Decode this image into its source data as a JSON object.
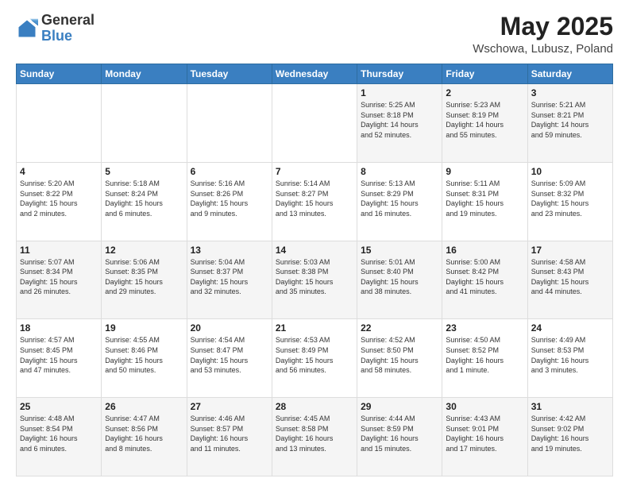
{
  "logo": {
    "general": "General",
    "blue": "Blue"
  },
  "header": {
    "title": "May 2025",
    "subtitle": "Wschowa, Lubusz, Poland"
  },
  "days_of_week": [
    "Sunday",
    "Monday",
    "Tuesday",
    "Wednesday",
    "Thursday",
    "Friday",
    "Saturday"
  ],
  "weeks": [
    [
      {
        "day": "",
        "info": ""
      },
      {
        "day": "",
        "info": ""
      },
      {
        "day": "",
        "info": ""
      },
      {
        "day": "",
        "info": ""
      },
      {
        "day": "1",
        "info": "Sunrise: 5:25 AM\nSunset: 8:18 PM\nDaylight: 14 hours\nand 52 minutes."
      },
      {
        "day": "2",
        "info": "Sunrise: 5:23 AM\nSunset: 8:19 PM\nDaylight: 14 hours\nand 55 minutes."
      },
      {
        "day": "3",
        "info": "Sunrise: 5:21 AM\nSunset: 8:21 PM\nDaylight: 14 hours\nand 59 minutes."
      }
    ],
    [
      {
        "day": "4",
        "info": "Sunrise: 5:20 AM\nSunset: 8:22 PM\nDaylight: 15 hours\nand 2 minutes."
      },
      {
        "day": "5",
        "info": "Sunrise: 5:18 AM\nSunset: 8:24 PM\nDaylight: 15 hours\nand 6 minutes."
      },
      {
        "day": "6",
        "info": "Sunrise: 5:16 AM\nSunset: 8:26 PM\nDaylight: 15 hours\nand 9 minutes."
      },
      {
        "day": "7",
        "info": "Sunrise: 5:14 AM\nSunset: 8:27 PM\nDaylight: 15 hours\nand 13 minutes."
      },
      {
        "day": "8",
        "info": "Sunrise: 5:13 AM\nSunset: 8:29 PM\nDaylight: 15 hours\nand 16 minutes."
      },
      {
        "day": "9",
        "info": "Sunrise: 5:11 AM\nSunset: 8:31 PM\nDaylight: 15 hours\nand 19 minutes."
      },
      {
        "day": "10",
        "info": "Sunrise: 5:09 AM\nSunset: 8:32 PM\nDaylight: 15 hours\nand 23 minutes."
      }
    ],
    [
      {
        "day": "11",
        "info": "Sunrise: 5:07 AM\nSunset: 8:34 PM\nDaylight: 15 hours\nand 26 minutes."
      },
      {
        "day": "12",
        "info": "Sunrise: 5:06 AM\nSunset: 8:35 PM\nDaylight: 15 hours\nand 29 minutes."
      },
      {
        "day": "13",
        "info": "Sunrise: 5:04 AM\nSunset: 8:37 PM\nDaylight: 15 hours\nand 32 minutes."
      },
      {
        "day": "14",
        "info": "Sunrise: 5:03 AM\nSunset: 8:38 PM\nDaylight: 15 hours\nand 35 minutes."
      },
      {
        "day": "15",
        "info": "Sunrise: 5:01 AM\nSunset: 8:40 PM\nDaylight: 15 hours\nand 38 minutes."
      },
      {
        "day": "16",
        "info": "Sunrise: 5:00 AM\nSunset: 8:42 PM\nDaylight: 15 hours\nand 41 minutes."
      },
      {
        "day": "17",
        "info": "Sunrise: 4:58 AM\nSunset: 8:43 PM\nDaylight: 15 hours\nand 44 minutes."
      }
    ],
    [
      {
        "day": "18",
        "info": "Sunrise: 4:57 AM\nSunset: 8:45 PM\nDaylight: 15 hours\nand 47 minutes."
      },
      {
        "day": "19",
        "info": "Sunrise: 4:55 AM\nSunset: 8:46 PM\nDaylight: 15 hours\nand 50 minutes."
      },
      {
        "day": "20",
        "info": "Sunrise: 4:54 AM\nSunset: 8:47 PM\nDaylight: 15 hours\nand 53 minutes."
      },
      {
        "day": "21",
        "info": "Sunrise: 4:53 AM\nSunset: 8:49 PM\nDaylight: 15 hours\nand 56 minutes."
      },
      {
        "day": "22",
        "info": "Sunrise: 4:52 AM\nSunset: 8:50 PM\nDaylight: 15 hours\nand 58 minutes."
      },
      {
        "day": "23",
        "info": "Sunrise: 4:50 AM\nSunset: 8:52 PM\nDaylight: 16 hours\nand 1 minute."
      },
      {
        "day": "24",
        "info": "Sunrise: 4:49 AM\nSunset: 8:53 PM\nDaylight: 16 hours\nand 3 minutes."
      }
    ],
    [
      {
        "day": "25",
        "info": "Sunrise: 4:48 AM\nSunset: 8:54 PM\nDaylight: 16 hours\nand 6 minutes."
      },
      {
        "day": "26",
        "info": "Sunrise: 4:47 AM\nSunset: 8:56 PM\nDaylight: 16 hours\nand 8 minutes."
      },
      {
        "day": "27",
        "info": "Sunrise: 4:46 AM\nSunset: 8:57 PM\nDaylight: 16 hours\nand 11 minutes."
      },
      {
        "day": "28",
        "info": "Sunrise: 4:45 AM\nSunset: 8:58 PM\nDaylight: 16 hours\nand 13 minutes."
      },
      {
        "day": "29",
        "info": "Sunrise: 4:44 AM\nSunset: 8:59 PM\nDaylight: 16 hours\nand 15 minutes."
      },
      {
        "day": "30",
        "info": "Sunrise: 4:43 AM\nSunset: 9:01 PM\nDaylight: 16 hours\nand 17 minutes."
      },
      {
        "day": "31",
        "info": "Sunrise: 4:42 AM\nSunset: 9:02 PM\nDaylight: 16 hours\nand 19 minutes."
      }
    ]
  ]
}
